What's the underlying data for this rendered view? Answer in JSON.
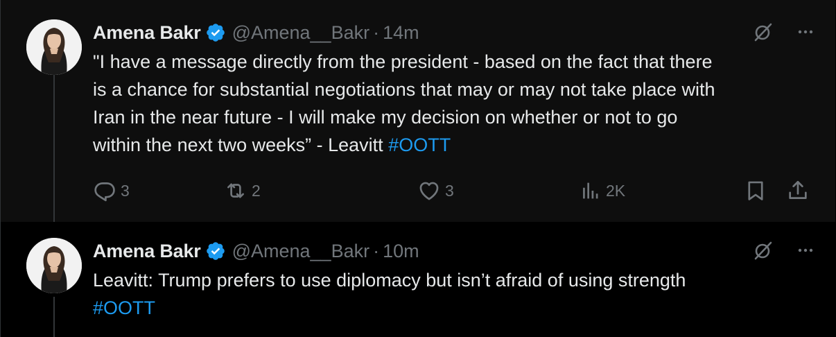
{
  "tweets": [
    {
      "display_name": "Amena Bakr",
      "handle": "@Amena__Bakr",
      "separator": "·",
      "time": "14m",
      "text": "\"I have a message directly from the president - based on the fact that there\nis a chance for substantial negotiations that may or may not take place with\nIran in the near future - I will make my decision on whether or not to go\nwithin the next two weeks” - Leavitt ",
      "hashtag": "#OOTT",
      "replies": "3",
      "reposts": "2",
      "likes": "3",
      "views": "2K"
    },
    {
      "display_name": "Amena Bakr",
      "handle": "@Amena__Bakr",
      "separator": "·",
      "time": "10m",
      "text": "Leavitt: Trump prefers to use diplomacy but isn’t afraid of using strength\n",
      "hashtag": "#OOTT"
    }
  ],
  "colors": {
    "accent": "#1d9bf0",
    "secondary_text": "#71767b",
    "primary_text": "#e7e9ea"
  },
  "icons": [
    "avatar",
    "verified-badge-icon",
    "grok-icon",
    "more-icon",
    "reply-icon",
    "repost-icon",
    "like-icon",
    "views-icon",
    "bookmark-icon",
    "share-icon"
  ]
}
